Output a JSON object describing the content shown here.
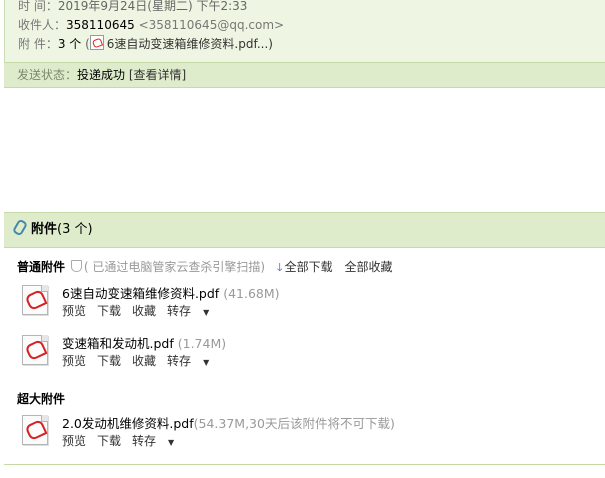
{
  "header": {
    "time_label": "时   间：",
    "time_value": "2019年9月24日(星期二) 下午2:33",
    "recipient_label": "收件人：",
    "recipient_name": "358110645",
    "recipient_email": "<358110645@qq.com>",
    "attachment_label": "附   件：",
    "attachment_count": "3 个",
    "attachment_open_paren": "(",
    "attachment_preview": "6速自动变速箱维修资料.pdf...)",
    "status_label": "发送状态：",
    "status_value": "投递成功",
    "status_detail_link": "[查看详情]"
  },
  "attachments": {
    "title": "附件",
    "count": "(3 个)",
    "normal": {
      "title": "普通附件",
      "scan_text": "(  已通过电脑管家云查杀引擎扫描)",
      "download_all": "全部下载",
      "collect_all": "全部收藏",
      "files": [
        {
          "name": "6速自动变速箱维修资料.pdf",
          "size": "(41.68M)",
          "actions": [
            "预览",
            "下载",
            "收藏",
            "转存"
          ]
        },
        {
          "name": "变速箱和发动机.pdf",
          "size": "(1.74M)",
          "actions": [
            "预览",
            "下载",
            "收藏",
            "转存"
          ]
        }
      ]
    },
    "large": {
      "title": "超大附件",
      "files": [
        {
          "name": "2.0发动机维修资料.pdf",
          "size": "(54.37M,30天后该附件将不可下载)",
          "actions": [
            "预览",
            "下载",
            "转存"
          ]
        }
      ]
    }
  },
  "icons": {
    "attachment": "paperclip-icon",
    "file": "pdf-icon",
    "scan": "shield-icon",
    "download": "down-arrow-icon",
    "dropdown": "caret-down-icon"
  },
  "colors": {
    "header_bg": "#eef6e3",
    "section_bar_bg": "#dfeccc",
    "border": "#c6daa8",
    "muted_text": "#999999",
    "pdf_red": "#d82020"
  }
}
